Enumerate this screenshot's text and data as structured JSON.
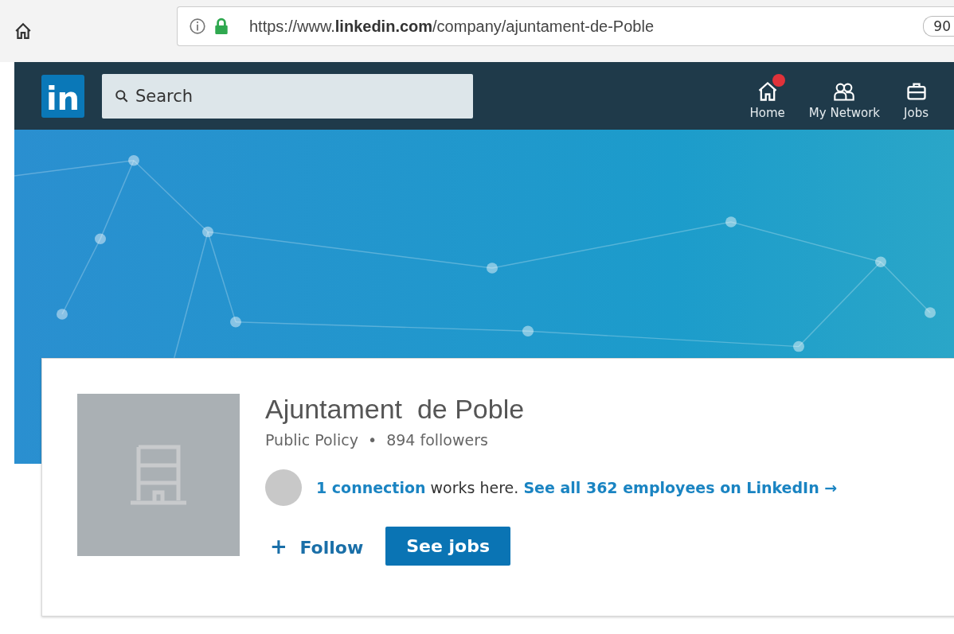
{
  "browser": {
    "url_prefix": "https://www.",
    "url_domain": "linkedin.com",
    "url_path": "/company/ajuntament-de-Poble",
    "zoom": "90"
  },
  "navbar": {
    "logo": "in",
    "search": {
      "placeholder": "Search"
    },
    "items": [
      {
        "label": "Home",
        "kind": "home",
        "notification": true
      },
      {
        "label": "My Network",
        "kind": "network",
        "notification": false
      },
      {
        "label": "Jobs",
        "kind": "jobs",
        "notification": false
      }
    ]
  },
  "company": {
    "name": "Ajuntament  de Poble",
    "industry": "Public Policy",
    "separator": "•",
    "followers": "894 followers",
    "connection_link": "1 connection",
    "connection_text": "works here.",
    "employees_link": "See all 362 employees on LinkedIn",
    "employees_arrow": "→",
    "buttons": [
      {
        "kind": "follow",
        "icon": "+",
        "label": "Follow"
      },
      {
        "kind": "primary",
        "label": "See jobs"
      }
    ]
  }
}
